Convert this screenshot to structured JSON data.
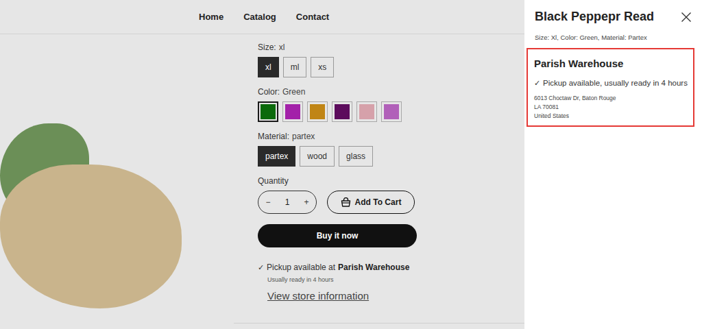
{
  "nav": [
    {
      "label": "Home"
    },
    {
      "label": "Catalog"
    },
    {
      "label": "Contact"
    }
  ],
  "options": [
    {
      "label": "Size:",
      "value": "xl",
      "kind": "button",
      "choices": [
        {
          "label": "xl",
          "selected": true
        },
        {
          "label": "ml",
          "selected": false
        },
        {
          "label": "xs",
          "selected": false
        }
      ]
    },
    {
      "label": "Color:",
      "value": "Green",
      "kind": "swatch",
      "choices": [
        {
          "color": "#0b6a0b",
          "selected": true
        },
        {
          "color": "#a321a9",
          "selected": false
        },
        {
          "color": "#c08515",
          "selected": false
        },
        {
          "color": "#5c0b5c",
          "selected": false
        },
        {
          "color": "#d6a1aa",
          "selected": false
        },
        {
          "color": "#b160b9",
          "selected": false
        }
      ]
    },
    {
      "label": "Material:",
      "value": "partex",
      "kind": "button",
      "choices": [
        {
          "label": "partex",
          "selected": true
        },
        {
          "label": "wood",
          "selected": false
        },
        {
          "label": "glass",
          "selected": false
        }
      ]
    }
  ],
  "quantity": {
    "label": "Quantity",
    "value": "1",
    "decrement": "−",
    "increment": "+"
  },
  "add_to_cart": "Add To Cart",
  "buy_now": "Buy it now",
  "pickup": {
    "check": "✓",
    "text": "Pickup available at",
    "store": "Parish Warehouse",
    "note": "Usually ready in 4 hours",
    "link": "View store information"
  },
  "drawer": {
    "title": "Black Peppepr Read",
    "variant": "Size: Xl, Color: Green, Material: Partex",
    "store": {
      "name": "Parish Warehouse",
      "check": "✓",
      "availability": "Pickup available, usually ready in 4 hours",
      "address": [
        "6013 Choctaw Dr, Baton Rouge",
        "LA 70081",
        "United States"
      ]
    }
  }
}
